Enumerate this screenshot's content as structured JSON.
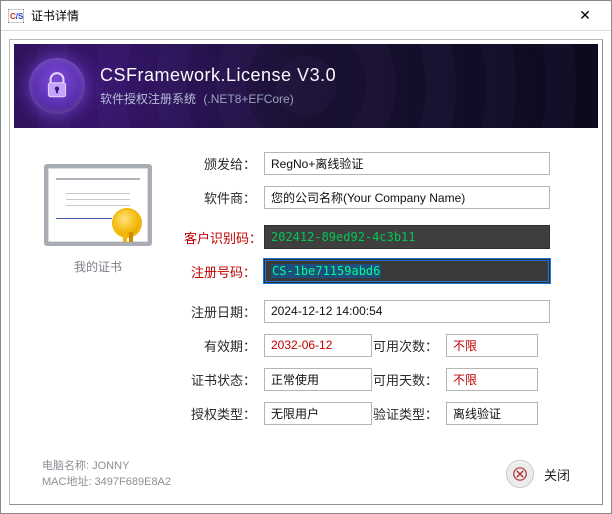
{
  "window": {
    "title": "证书详情"
  },
  "banner": {
    "title": "CSFramework.License V3.0",
    "subtitle": "软件授权注册系统",
    "suffix": "(.NET8+EFCore)"
  },
  "cert": {
    "caption": "我的证书"
  },
  "labels": {
    "issuedTo": "颁发给",
    "vendor": "软件商",
    "customerId": "客户识别码",
    "regNo": "注册号码",
    "regDate": "注册日期",
    "expire": "有效期",
    "usageCount": "可用次数",
    "status": "证书状态",
    "usageDays": "可用天数",
    "authType": "授权类型",
    "verifyType": "验证类型"
  },
  "values": {
    "issuedTo": "RegNo+离线验证",
    "vendor": "您的公司名称(Your Company Name)",
    "customerId": "202412-89ed92-4c3b11",
    "regNo": "CS-1be71159abd6",
    "regDate": "2024-12-12 14:00:54",
    "expire": "2032-06-12",
    "usageCount": "不限",
    "status": "正常使用",
    "usageDays": "不限",
    "authType": "无限用户",
    "verifyType": "离线验证"
  },
  "footer": {
    "hostLabel": "电脑名称:",
    "hostValue": "JONNY",
    "macLabel": "MAC地址:",
    "macValue": "3497F689E8A2",
    "closeLabel": "关闭"
  }
}
